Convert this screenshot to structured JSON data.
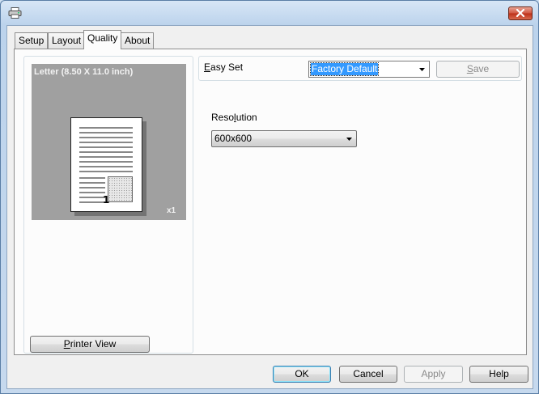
{
  "window": {
    "title": "",
    "icons": {
      "app": "printer-icon",
      "close": "close-icon"
    }
  },
  "tabs": [
    {
      "label": "Setup",
      "active": false
    },
    {
      "label": "Layout",
      "active": false
    },
    {
      "label": "Quality",
      "active": true
    },
    {
      "label": "About",
      "active": false
    }
  ],
  "preview": {
    "paper_label": "Letter (8.50 X 11.0 inch)",
    "copies_label": "x1",
    "page_number": "1",
    "printer_view_button": {
      "pre": "",
      "mnemonic": "P",
      "post": "rinter View"
    }
  },
  "easy_set": {
    "label_mnemonic": "E",
    "label_rest": "asy Set",
    "selected": "Factory Default",
    "save_button": {
      "mnemonic": "S",
      "rest": "ave",
      "enabled": false
    }
  },
  "resolution": {
    "label_pre": "Reso",
    "label_mnemonic": "l",
    "label_post": "ution",
    "selected": "600x600"
  },
  "footer": {
    "ok": "OK",
    "cancel": "Cancel",
    "apply": "Apply",
    "help": "Help"
  }
}
